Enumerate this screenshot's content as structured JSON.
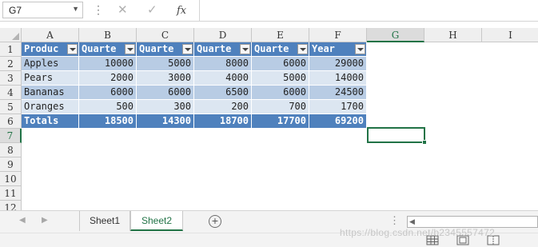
{
  "formula_bar": {
    "name_box": "G7",
    "cancel_icon": "close-icon",
    "confirm_icon": "check-icon",
    "function_label": "fx",
    "formula": ""
  },
  "grid": {
    "columns": [
      "A",
      "B",
      "C",
      "D",
      "E",
      "F",
      "G",
      "H",
      "I"
    ],
    "rows": [
      "1",
      "2",
      "3",
      "4",
      "5",
      "6",
      "7",
      "8",
      "9",
      "10",
      "11",
      "12"
    ],
    "selected_column": "G",
    "selected_row": "7"
  },
  "table": {
    "headers": [
      "Produc",
      "Quarte",
      "Quarte",
      "Quarte",
      "Quarte",
      "Year"
    ],
    "rows": [
      [
        "Apples",
        "10000",
        "5000",
        "8000",
        "6000",
        "29000"
      ],
      [
        "Pears",
        "2000",
        "3000",
        "4000",
        "5000",
        "14000"
      ],
      [
        "Bananas",
        "6000",
        "6000",
        "6500",
        "6000",
        "24500"
      ],
      [
        "Oranges",
        "500",
        "300",
        "200",
        "700",
        "1700"
      ]
    ],
    "totals": [
      "Totals",
      "18500",
      "14300",
      "18700",
      "17700",
      "69200"
    ],
    "colors": {
      "header": "#4f81bd",
      "band_dark": "#b8cce4",
      "band_light": "#dce6f1",
      "totals": "#4f81bd"
    }
  },
  "sheets": {
    "tabs": [
      "Sheet1",
      "Sheet2"
    ],
    "active": "Sheet2",
    "add_icon": "plus-circle-icon"
  },
  "status_bar": {
    "views": [
      "normal-view-icon",
      "page-layout-icon",
      "page-break-icon"
    ]
  },
  "watermark": "https://blog.csdn.net/b2345557472"
}
